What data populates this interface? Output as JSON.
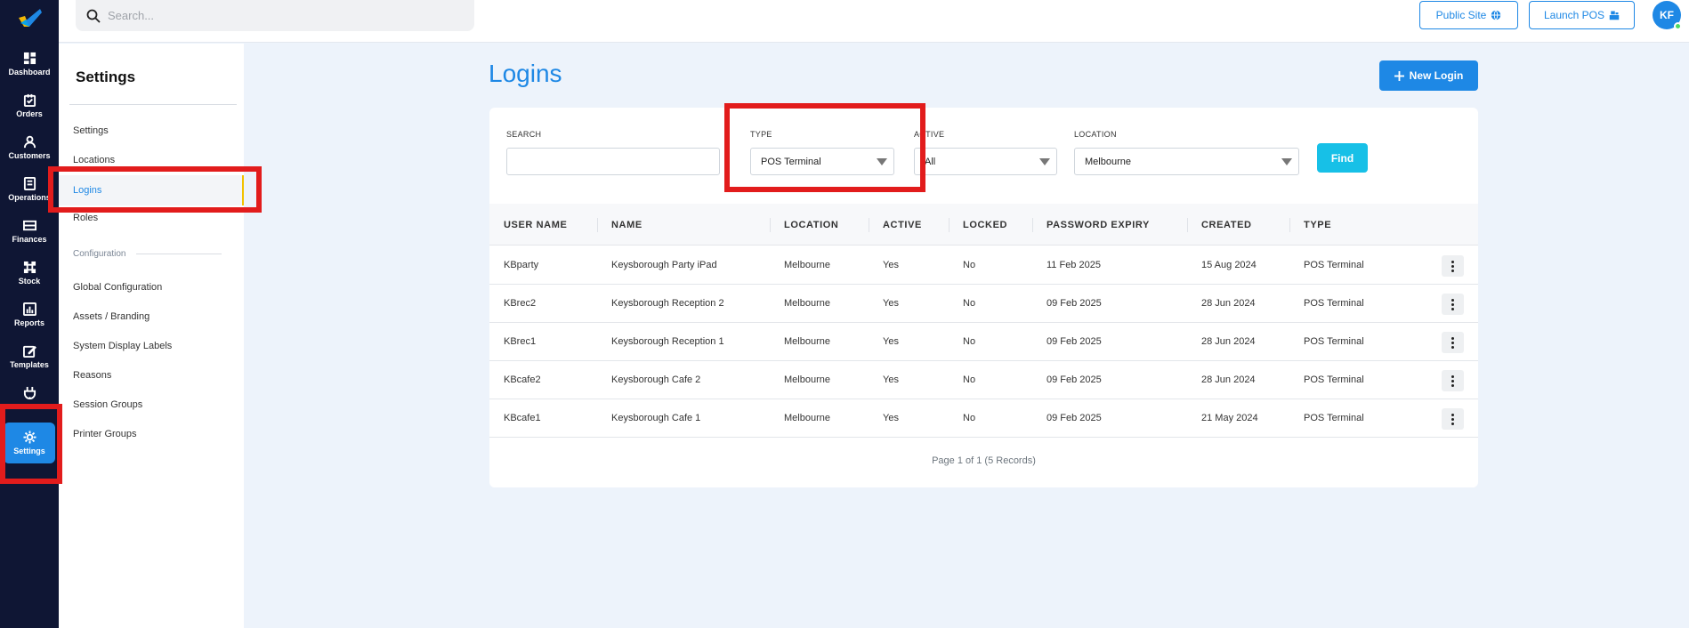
{
  "rail": {
    "items": [
      {
        "label": "Dashboard",
        "icon": "dashboard-icon"
      },
      {
        "label": "Orders",
        "icon": "orders-icon"
      },
      {
        "label": "Customers",
        "icon": "customers-icon"
      },
      {
        "label": "Operations",
        "icon": "operations-icon"
      },
      {
        "label": "Finances",
        "icon": "finances-icon"
      },
      {
        "label": "Stock",
        "icon": "stock-icon"
      },
      {
        "label": "Reports",
        "icon": "reports-icon"
      },
      {
        "label": "Templates",
        "icon": "templates-icon"
      },
      {
        "label": "",
        "icon": "plug-icon"
      },
      {
        "label": "Settings",
        "icon": "gear-icon"
      }
    ],
    "active": "Settings"
  },
  "header": {
    "search_placeholder": "Search...",
    "public_site": "Public Site",
    "launch_pos": "Launch POS",
    "avatar_initials": "KF"
  },
  "subnav": {
    "title": "Settings",
    "items": [
      "Settings",
      "Locations",
      "Logins",
      "Roles"
    ],
    "active": "Logins",
    "section_label": "Configuration",
    "config_items": [
      "Global Configuration",
      "Assets / Branding",
      "System Display Labels",
      "Reasons",
      "Session Groups",
      "Printer Groups"
    ]
  },
  "main": {
    "title": "Logins",
    "new_button": "New Login",
    "filters": {
      "search_label": "SEARCH",
      "search_value": "",
      "type_label": "TYPE",
      "type_value": "POS Terminal",
      "active_label": "ACTIVE",
      "active_value": "All",
      "location_label": "LOCATION",
      "location_value": "Melbourne",
      "find_button": "Find"
    },
    "columns": [
      "USER NAME",
      "NAME",
      "LOCATION",
      "ACTIVE",
      "LOCKED",
      "PASSWORD EXPIRY",
      "CREATED",
      "TYPE"
    ],
    "rows": [
      [
        "KBparty",
        "Keysborough Party iPad",
        "Melbourne",
        "Yes",
        "No",
        "11 Feb 2025",
        "15 Aug 2024",
        "POS Terminal"
      ],
      [
        "KBrec2",
        "Keysborough Reception 2",
        "Melbourne",
        "Yes",
        "No",
        "09 Feb 2025",
        "28 Jun 2024",
        "POS Terminal"
      ],
      [
        "KBrec1",
        "Keysborough Reception 1",
        "Melbourne",
        "Yes",
        "No",
        "09 Feb 2025",
        "28 Jun 2024",
        "POS Terminal"
      ],
      [
        "KBcafe2",
        "Keysborough Cafe 2",
        "Melbourne",
        "Yes",
        "No",
        "09 Feb 2025",
        "28 Jun 2024",
        "POS Terminal"
      ],
      [
        "KBcafe1",
        "Keysborough Cafe 1",
        "Melbourne",
        "Yes",
        "No",
        "09 Feb 2025",
        "21 May 2024",
        "POS Terminal"
      ]
    ],
    "pagination": "Page 1 of 1 (5 Records)"
  },
  "colors": {
    "accent": "#1e88e5",
    "rail": "#0f1634",
    "find": "#17c0e7",
    "highlight": "#e21c1c"
  }
}
